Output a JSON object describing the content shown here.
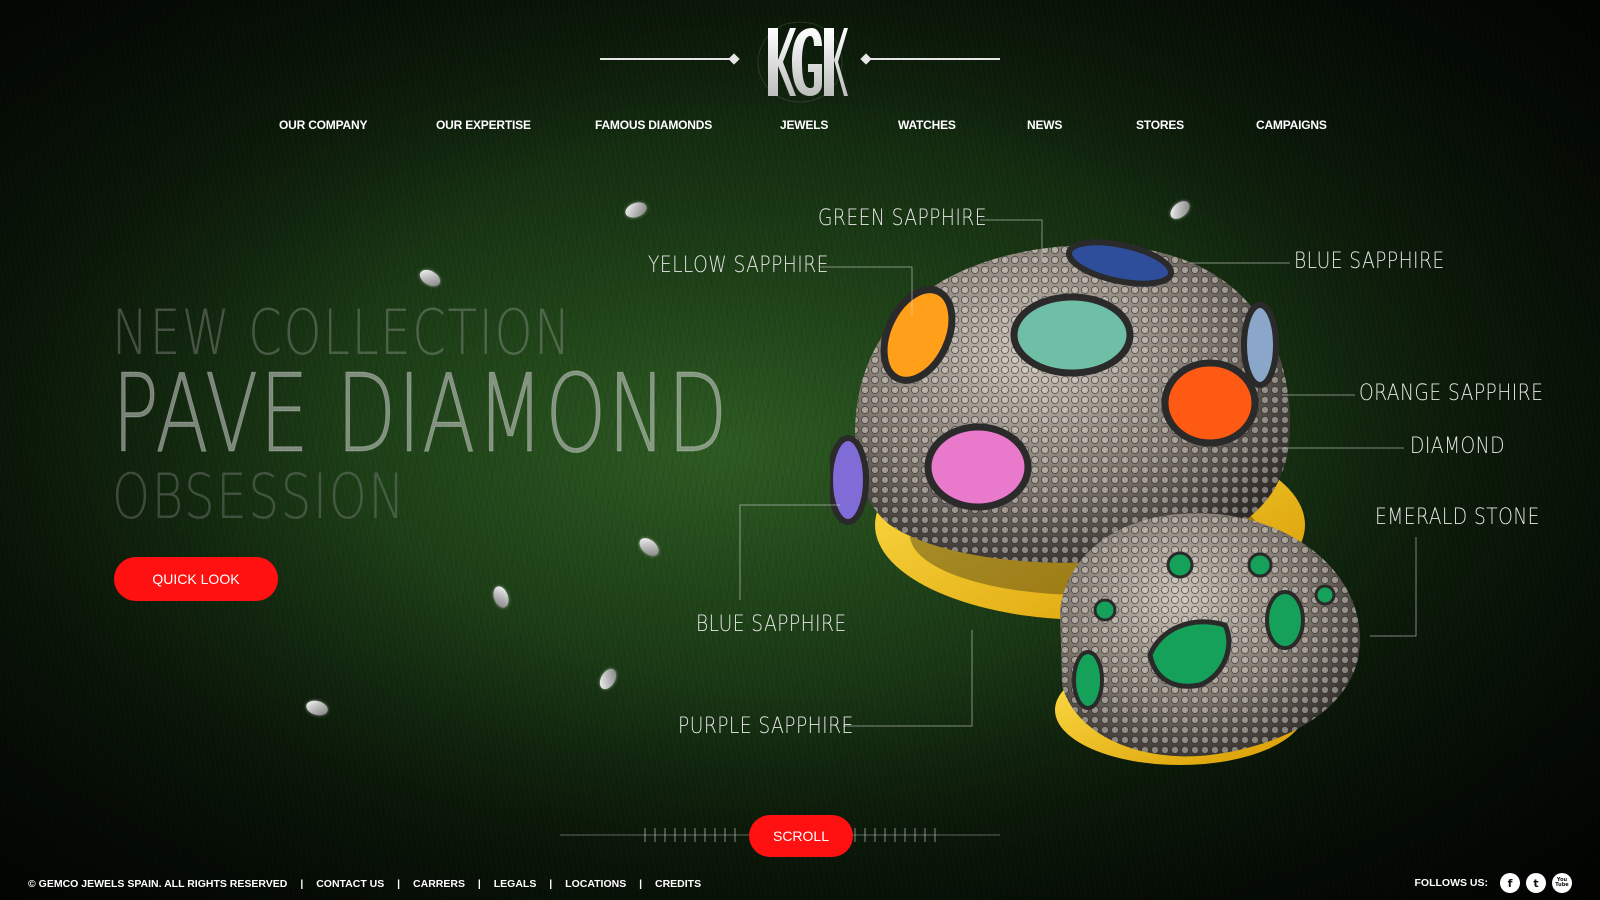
{
  "brand": {
    "logo_text": "KGK"
  },
  "nav": {
    "items": [
      {
        "label": "OUR COMPANY"
      },
      {
        "label": "OUR EXPERTISE"
      },
      {
        "label": "FAMOUS DIAMONDS"
      },
      {
        "label": "JEWELS"
      },
      {
        "label": "WATCHES"
      },
      {
        "label": "NEWS"
      },
      {
        "label": "STORES"
      },
      {
        "label": "CAMPAIGNS"
      }
    ]
  },
  "hero": {
    "line1": "NEW COLLECTION",
    "line2": "PAVE DIAMOND",
    "line3": "OBSESSION",
    "cta_label": "QUICK LOOK"
  },
  "callouts": {
    "green_sapphire": "GREEN SAPPHIRE",
    "yellow_sapphire": "YELLOW SAPPHIRE",
    "blue_sapphire_top": "BLUE SAPPHIRE",
    "orange_sapphire": "ORANGE SAPPHIRE",
    "diamond": "DIAMOND",
    "emerald_stone": "EMERALD STONE",
    "blue_sapphire_bottom": "BLUE SAPPHIRE",
    "purple_sapphire": "PURPLE SAPPHIRE"
  },
  "scroll": {
    "label": "SCROLL"
  },
  "footer": {
    "copyright": "© GEMCO JEWELS SPAIN. ALL RIGHTS RESERVED",
    "links": [
      {
        "label": "CONTACT US"
      },
      {
        "label": "CARRERS"
      },
      {
        "label": "LEGALS"
      },
      {
        "label": "LOCATIONS"
      },
      {
        "label": "CREDITS"
      }
    ],
    "follow_label": "FOLLOWS US:",
    "social": [
      {
        "name": "facebook-icon",
        "glyph": "f"
      },
      {
        "name": "twitter-icon",
        "glyph": "t"
      },
      {
        "name": "youtube-icon",
        "glyph": "You Tube"
      }
    ]
  },
  "colors": {
    "accent_red": "#ff1111",
    "text_white": "#ffffff",
    "background_green": "#1c3d16"
  }
}
